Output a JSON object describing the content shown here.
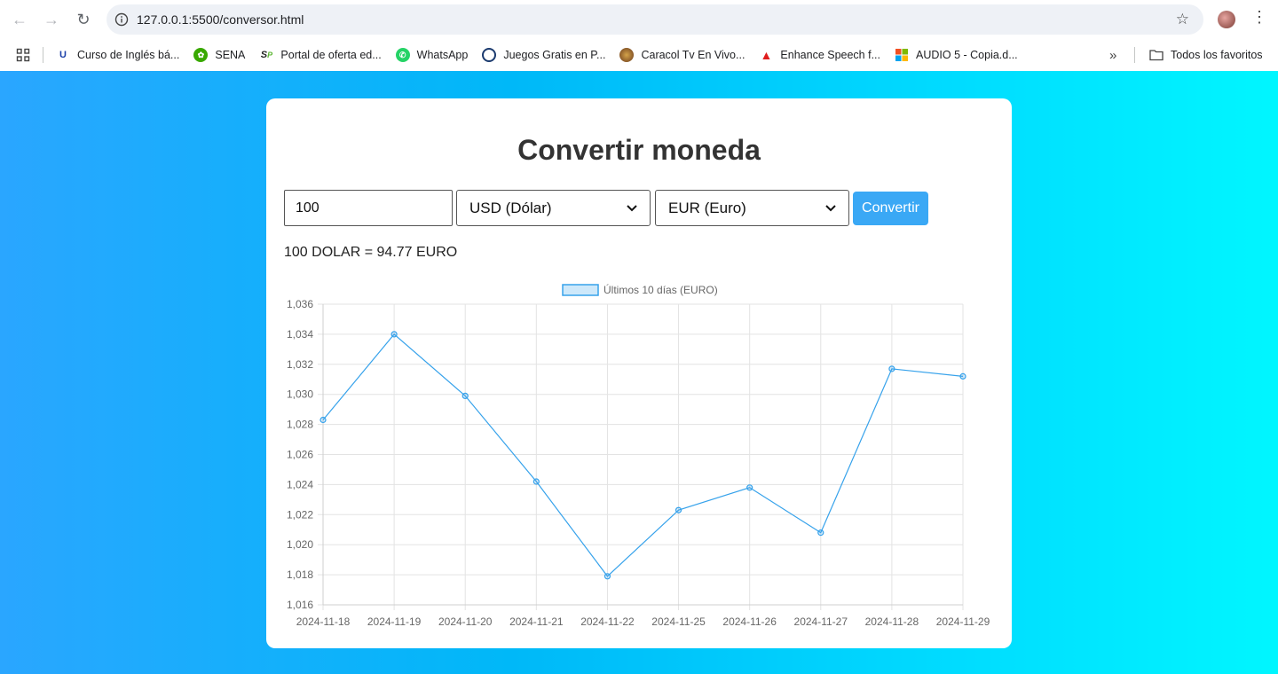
{
  "browser": {
    "url": "127.0.0.1:5500/conversor.html",
    "bookmarks": [
      {
        "label": "Curso de Inglés bá...",
        "icon": "u-icon"
      },
      {
        "label": "SENA",
        "icon": "sena-icon"
      },
      {
        "label": "Portal de oferta ed...",
        "icon": "sp-icon"
      },
      {
        "label": "WhatsApp",
        "icon": "whatsapp-icon"
      },
      {
        "label": "Juegos Gratis en P...",
        "icon": "games-icon"
      },
      {
        "label": "Caracol Tv En Vivo...",
        "icon": "caracol-icon"
      },
      {
        "label": "Enhance Speech f...",
        "icon": "adobe-icon"
      },
      {
        "label": "AUDIO 5 - Copia.d...",
        "icon": "office-icon"
      }
    ],
    "all_bookmarks": "Todos los favoritos"
  },
  "converter": {
    "title": "Convertir moneda",
    "amount_value": "100",
    "from_currency": "USD (Dólar)",
    "to_currency": "EUR (Euro)",
    "convert_label": "Convertir",
    "result": "100 DOLAR = 94.77 EURO"
  },
  "chart_data": {
    "type": "line",
    "legend": "Últimos 10 días (EURO)",
    "categories": [
      "2024-11-18",
      "2024-11-19",
      "2024-11-20",
      "2024-11-21",
      "2024-11-22",
      "2024-11-25",
      "2024-11-26",
      "2024-11-27",
      "2024-11-28",
      "2024-11-29"
    ],
    "values": [
      1.0283,
      1.034,
      1.0299,
      1.0242,
      1.0179,
      1.0223,
      1.0238,
      1.0208,
      1.0317,
      1.0312
    ],
    "ylim": [
      1.016,
      1.036
    ],
    "yticks": [
      1.036,
      1.034,
      1.032,
      1.03,
      1.028,
      1.026,
      1.024,
      1.022,
      1.02,
      1.018,
      1.016
    ],
    "ytick_labels": [
      "1,036",
      "1,034",
      "1,032",
      "1,030",
      "1,028",
      "1,026",
      "1,024",
      "1,022",
      "1,020",
      "1,018",
      "1,016"
    ],
    "grid": true,
    "legend_position": "top-center",
    "color": "#36a2eb"
  }
}
